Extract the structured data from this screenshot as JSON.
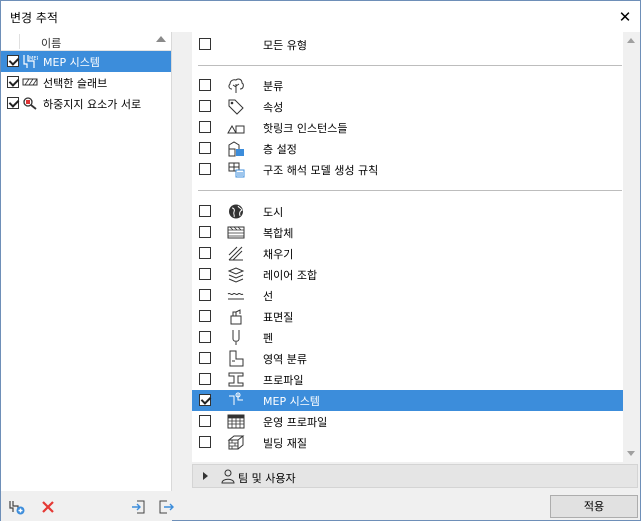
{
  "window": {
    "title": "변경 추적",
    "close_glyph": "✕"
  },
  "left_panel": {
    "column_header": "이름",
    "items": [
      {
        "label": "MEP 시스템",
        "checked": true,
        "selected": true,
        "icon": "mep-system-icon"
      },
      {
        "label": "선택한 슬래브",
        "checked": true,
        "selected": false,
        "icon": "slab-icon"
      },
      {
        "label": "하중지지 요소가 서로",
        "checked": true,
        "selected": false,
        "icon": "magnifier-icon"
      }
    ],
    "toolbar": {
      "add": "add-criteria-icon",
      "delete": "delete-icon",
      "import": "import-icon",
      "export": "export-icon"
    }
  },
  "right_panel": {
    "rows": [
      {
        "label": "모든 유형",
        "checked": false,
        "icon": ""
      },
      {
        "label": "분류",
        "checked": false,
        "icon": "classification-icon"
      },
      {
        "label": "속성",
        "checked": false,
        "icon": "tag-icon"
      },
      {
        "label": "핫링크 인스턴스들",
        "checked": false,
        "icon": "hotlink-icon"
      },
      {
        "label": "층 설정",
        "checked": false,
        "icon": "story-settings-icon"
      },
      {
        "label": "구조 해석 모델 생성 규칙",
        "checked": false,
        "icon": "structural-rules-icon"
      },
      {
        "label": "도시",
        "checked": false,
        "icon": "globe-icon"
      },
      {
        "label": "복합체",
        "checked": false,
        "icon": "composite-icon"
      },
      {
        "label": "채우기",
        "checked": false,
        "icon": "fill-icon"
      },
      {
        "label": "레이어 조합",
        "checked": false,
        "icon": "layer-combination-icon"
      },
      {
        "label": "선",
        "checked": false,
        "icon": "line-type-icon"
      },
      {
        "label": "표면질",
        "checked": false,
        "icon": "surface-icon"
      },
      {
        "label": "펜",
        "checked": false,
        "icon": "pen-icon"
      },
      {
        "label": "영역 분류",
        "checked": false,
        "icon": "zone-category-icon"
      },
      {
        "label": "프로파일",
        "checked": false,
        "icon": "profile-icon"
      },
      {
        "label": "MEP 시스템",
        "checked": true,
        "icon": "mep-system-icon"
      },
      {
        "label": "운영 프로파일",
        "checked": false,
        "icon": "operation-profile-icon"
      },
      {
        "label": "빌딩 재질",
        "checked": false,
        "icon": "building-material-icon"
      }
    ],
    "section_label": "팀 및 사용자",
    "apply_label": "적용"
  }
}
